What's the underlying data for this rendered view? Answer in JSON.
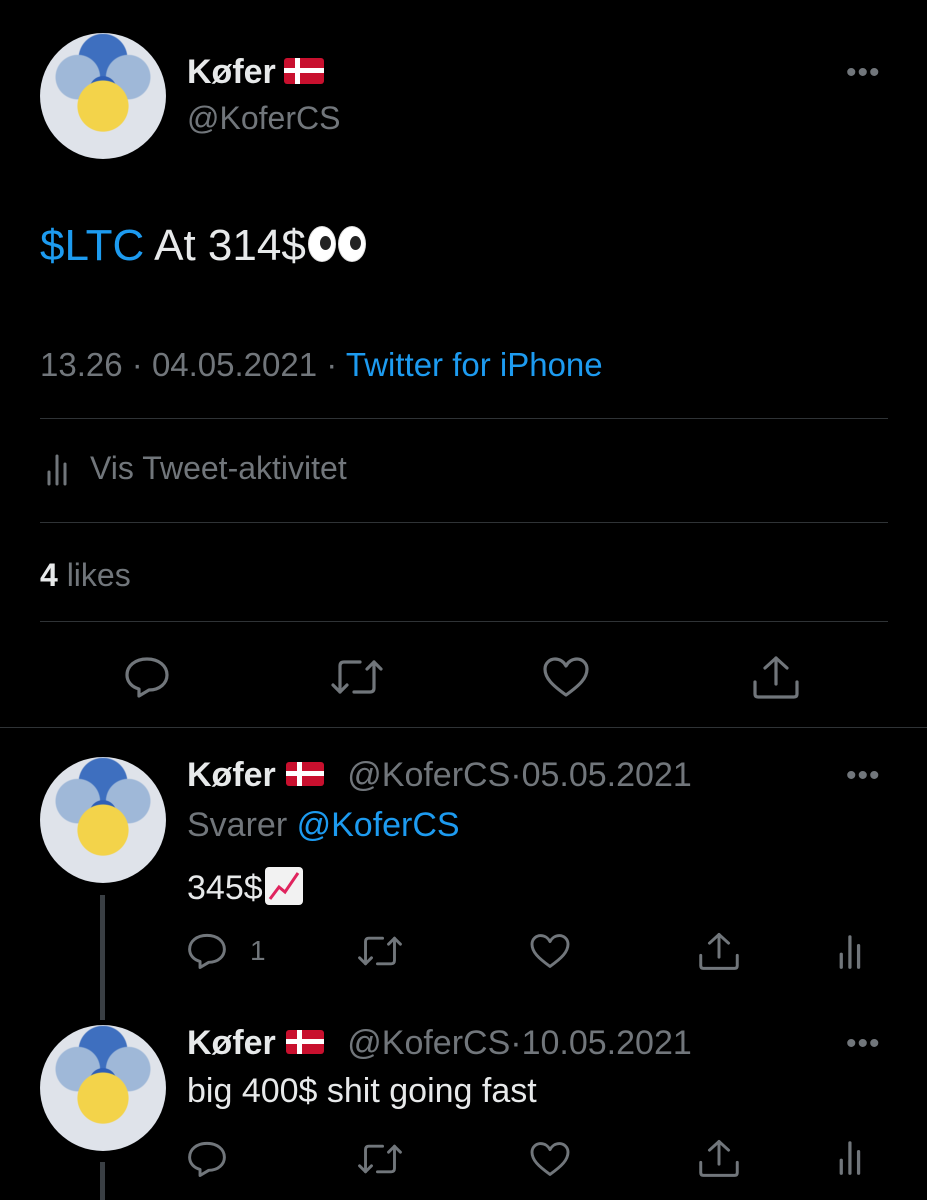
{
  "main_tweet": {
    "display_name": "Køfer",
    "handle": "@KoferCS",
    "text_cashtag": "$LTC",
    "text_rest": " At 314$",
    "time": "13.26",
    "date": "04.05.2021",
    "source": "Twitter for iPhone",
    "activity_label": "Vis Tweet-aktivitet",
    "likes_count": "4",
    "likes_label": " likes"
  },
  "reply1": {
    "display_name": "Køfer",
    "handle": "@KoferCS",
    "date": "05.05.2021",
    "replying_label": "Svarer",
    "replying_to": "@KoferCS",
    "text": "345$",
    "reply_count": "1"
  },
  "reply2": {
    "display_name": "Køfer",
    "handle": "@KoferCS",
    "date": "10.05.2021",
    "text": "big 400$ shit going fast"
  },
  "separator_dot": "·",
  "icons": {
    "more": "more-icon",
    "reply": "reply-icon",
    "retweet": "retweet-icon",
    "like": "like-icon",
    "share": "share-icon",
    "analytics": "analytics-icon",
    "flag": "denmark-flag-icon"
  },
  "colors": {
    "background": "#000000",
    "text": "#e7e9ea",
    "muted": "#71767b",
    "accent": "#1d9bf0",
    "divider": "#2f3336"
  }
}
